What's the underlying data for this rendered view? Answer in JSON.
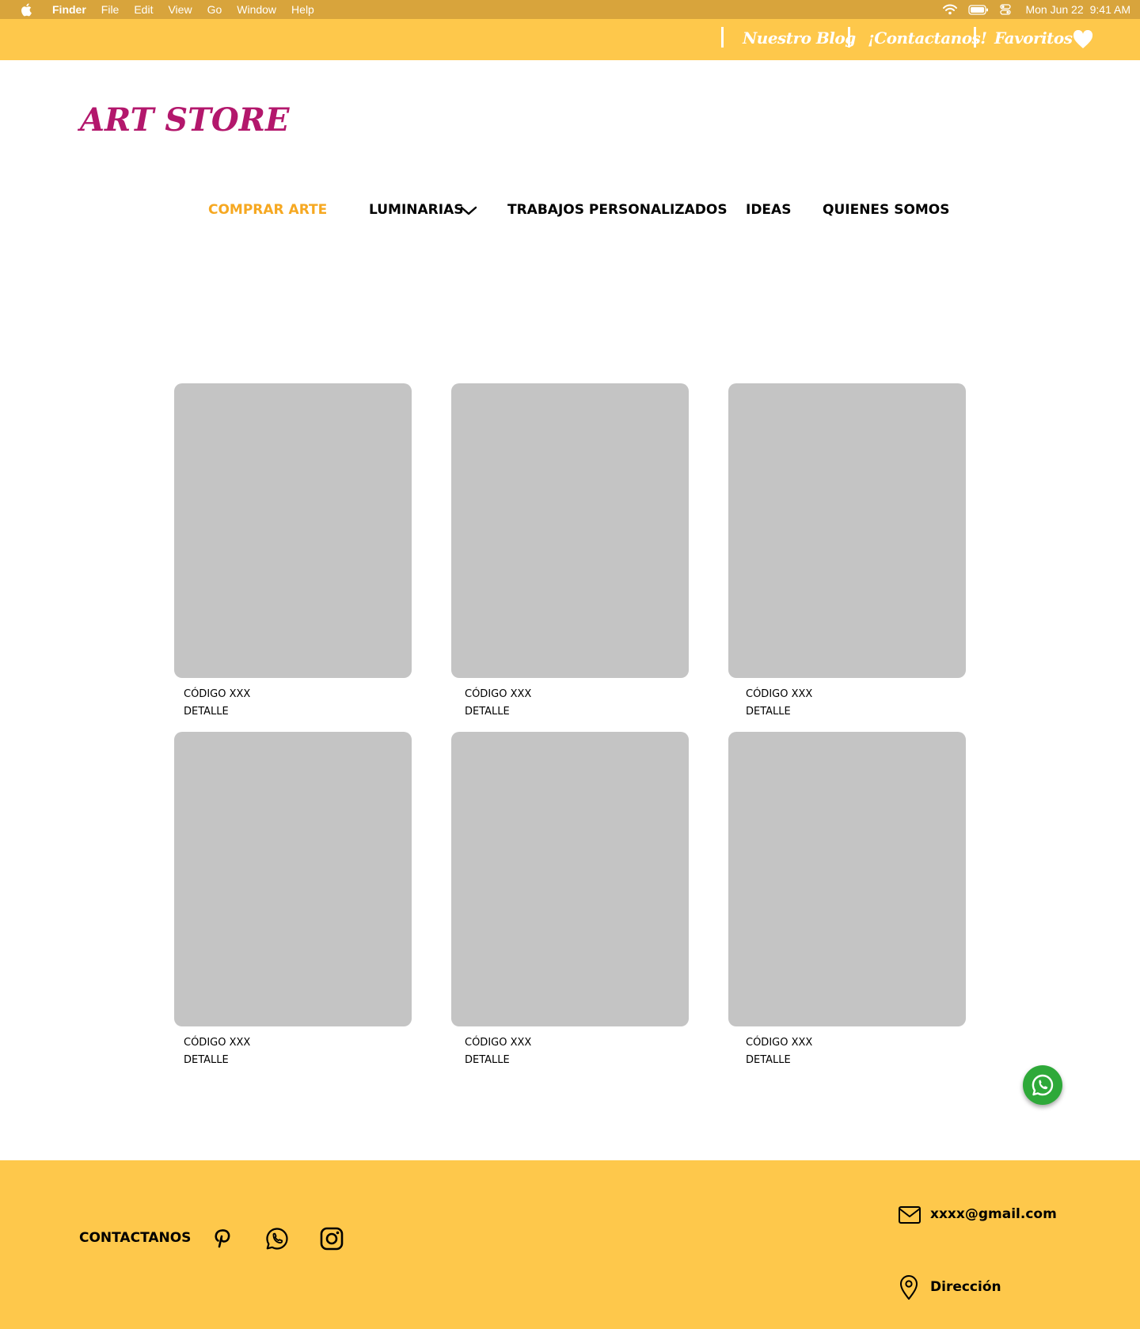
{
  "menubar": {
    "app_name": "Finder",
    "menus": [
      "File",
      "Edit",
      "View",
      "Go",
      "Window",
      "Help"
    ],
    "date": "Mon Jun 22",
    "time": "9:41 AM",
    "icons": [
      "apple-icon",
      "wifi-icon",
      "battery-icon",
      "control-center-icon"
    ]
  },
  "topbar": {
    "blog": "Nuestro Blog",
    "contact": "¡Contactanos!",
    "favorites": "Favoritos",
    "icon": "heart-icon",
    "text_color": "#ffffff",
    "background": "#fec84b"
  },
  "logo": {
    "text": "ART STORE",
    "color": "#b3176c"
  },
  "nav": {
    "items": [
      {
        "label": "COMPRAR ARTE",
        "active": true
      },
      {
        "label": "LUMINARIAS",
        "has_dropdown": true
      },
      {
        "label": "TRABAJOS PERSONALIZADOS"
      },
      {
        "label": "IDEAS"
      },
      {
        "label": "QUIENES SOMOS"
      }
    ],
    "active_color": "#f6a821",
    "dropdown_icon": "chevron-down-icon"
  },
  "products": [
    {
      "code": "CÓDIGO XXX",
      "detail": "DETALLE"
    },
    {
      "code": "CÓDIGO XXX",
      "detail": "DETALLE"
    },
    {
      "code": "CÓDIGO XXX",
      "detail": "DETALLE"
    },
    {
      "code": "CÓDIGO XXX",
      "detail": "DETALLE"
    },
    {
      "code": "CÓDIGO XXX",
      "detail": "DETALLE"
    },
    {
      "code": "CÓDIGO XXX",
      "detail": "DETALLE"
    }
  ],
  "product_placeholder_color": "#c4c4c4",
  "whatsapp_float": {
    "icon": "whatsapp-icon",
    "color": "#2ea939"
  },
  "footer": {
    "contact_title": "CONTACTANOS",
    "social_icons": [
      "pinterest-icon",
      "whatsapp-icon",
      "instagram-icon"
    ],
    "email": "xxxx@gmail.com",
    "address": "Dirección",
    "background": "#fec84b"
  }
}
